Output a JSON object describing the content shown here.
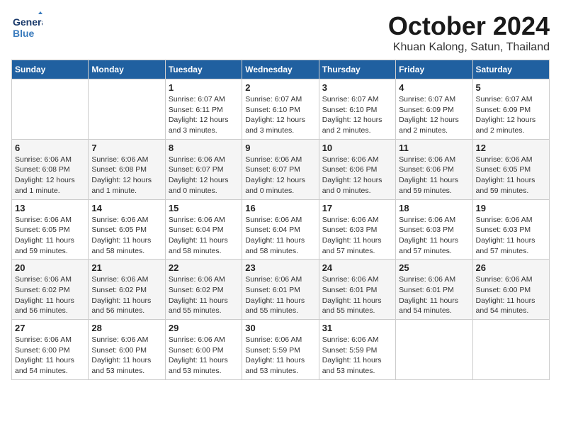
{
  "header": {
    "logo_line1": "General",
    "logo_line2": "Blue",
    "month": "October 2024",
    "location": "Khuan Kalong, Satun, Thailand"
  },
  "days_of_week": [
    "Sunday",
    "Monday",
    "Tuesday",
    "Wednesday",
    "Thursday",
    "Friday",
    "Saturday"
  ],
  "weeks": [
    [
      {
        "day": "",
        "info": ""
      },
      {
        "day": "",
        "info": ""
      },
      {
        "day": "1",
        "info": "Sunrise: 6:07 AM\nSunset: 6:11 PM\nDaylight: 12 hours\nand 3 minutes."
      },
      {
        "day": "2",
        "info": "Sunrise: 6:07 AM\nSunset: 6:10 PM\nDaylight: 12 hours\nand 3 minutes."
      },
      {
        "day": "3",
        "info": "Sunrise: 6:07 AM\nSunset: 6:10 PM\nDaylight: 12 hours\nand 2 minutes."
      },
      {
        "day": "4",
        "info": "Sunrise: 6:07 AM\nSunset: 6:09 PM\nDaylight: 12 hours\nand 2 minutes."
      },
      {
        "day": "5",
        "info": "Sunrise: 6:07 AM\nSunset: 6:09 PM\nDaylight: 12 hours\nand 2 minutes."
      }
    ],
    [
      {
        "day": "6",
        "info": "Sunrise: 6:06 AM\nSunset: 6:08 PM\nDaylight: 12 hours\nand 1 minute."
      },
      {
        "day": "7",
        "info": "Sunrise: 6:06 AM\nSunset: 6:08 PM\nDaylight: 12 hours\nand 1 minute."
      },
      {
        "day": "8",
        "info": "Sunrise: 6:06 AM\nSunset: 6:07 PM\nDaylight: 12 hours\nand 0 minutes."
      },
      {
        "day": "9",
        "info": "Sunrise: 6:06 AM\nSunset: 6:07 PM\nDaylight: 12 hours\nand 0 minutes."
      },
      {
        "day": "10",
        "info": "Sunrise: 6:06 AM\nSunset: 6:06 PM\nDaylight: 12 hours\nand 0 minutes."
      },
      {
        "day": "11",
        "info": "Sunrise: 6:06 AM\nSunset: 6:06 PM\nDaylight: 11 hours\nand 59 minutes."
      },
      {
        "day": "12",
        "info": "Sunrise: 6:06 AM\nSunset: 6:05 PM\nDaylight: 11 hours\nand 59 minutes."
      }
    ],
    [
      {
        "day": "13",
        "info": "Sunrise: 6:06 AM\nSunset: 6:05 PM\nDaylight: 11 hours\nand 59 minutes."
      },
      {
        "day": "14",
        "info": "Sunrise: 6:06 AM\nSunset: 6:05 PM\nDaylight: 11 hours\nand 58 minutes."
      },
      {
        "day": "15",
        "info": "Sunrise: 6:06 AM\nSunset: 6:04 PM\nDaylight: 11 hours\nand 58 minutes."
      },
      {
        "day": "16",
        "info": "Sunrise: 6:06 AM\nSunset: 6:04 PM\nDaylight: 11 hours\nand 58 minutes."
      },
      {
        "day": "17",
        "info": "Sunrise: 6:06 AM\nSunset: 6:03 PM\nDaylight: 11 hours\nand 57 minutes."
      },
      {
        "day": "18",
        "info": "Sunrise: 6:06 AM\nSunset: 6:03 PM\nDaylight: 11 hours\nand 57 minutes."
      },
      {
        "day": "19",
        "info": "Sunrise: 6:06 AM\nSunset: 6:03 PM\nDaylight: 11 hours\nand 57 minutes."
      }
    ],
    [
      {
        "day": "20",
        "info": "Sunrise: 6:06 AM\nSunset: 6:02 PM\nDaylight: 11 hours\nand 56 minutes."
      },
      {
        "day": "21",
        "info": "Sunrise: 6:06 AM\nSunset: 6:02 PM\nDaylight: 11 hours\nand 56 minutes."
      },
      {
        "day": "22",
        "info": "Sunrise: 6:06 AM\nSunset: 6:02 PM\nDaylight: 11 hours\nand 55 minutes."
      },
      {
        "day": "23",
        "info": "Sunrise: 6:06 AM\nSunset: 6:01 PM\nDaylight: 11 hours\nand 55 minutes."
      },
      {
        "day": "24",
        "info": "Sunrise: 6:06 AM\nSunset: 6:01 PM\nDaylight: 11 hours\nand 55 minutes."
      },
      {
        "day": "25",
        "info": "Sunrise: 6:06 AM\nSunset: 6:01 PM\nDaylight: 11 hours\nand 54 minutes."
      },
      {
        "day": "26",
        "info": "Sunrise: 6:06 AM\nSunset: 6:00 PM\nDaylight: 11 hours\nand 54 minutes."
      }
    ],
    [
      {
        "day": "27",
        "info": "Sunrise: 6:06 AM\nSunset: 6:00 PM\nDaylight: 11 hours\nand 54 minutes."
      },
      {
        "day": "28",
        "info": "Sunrise: 6:06 AM\nSunset: 6:00 PM\nDaylight: 11 hours\nand 53 minutes."
      },
      {
        "day": "29",
        "info": "Sunrise: 6:06 AM\nSunset: 6:00 PM\nDaylight: 11 hours\nand 53 minutes."
      },
      {
        "day": "30",
        "info": "Sunrise: 6:06 AM\nSunset: 5:59 PM\nDaylight: 11 hours\nand 53 minutes."
      },
      {
        "day": "31",
        "info": "Sunrise: 6:06 AM\nSunset: 5:59 PM\nDaylight: 11 hours\nand 53 minutes."
      },
      {
        "day": "",
        "info": ""
      },
      {
        "day": "",
        "info": ""
      }
    ]
  ]
}
